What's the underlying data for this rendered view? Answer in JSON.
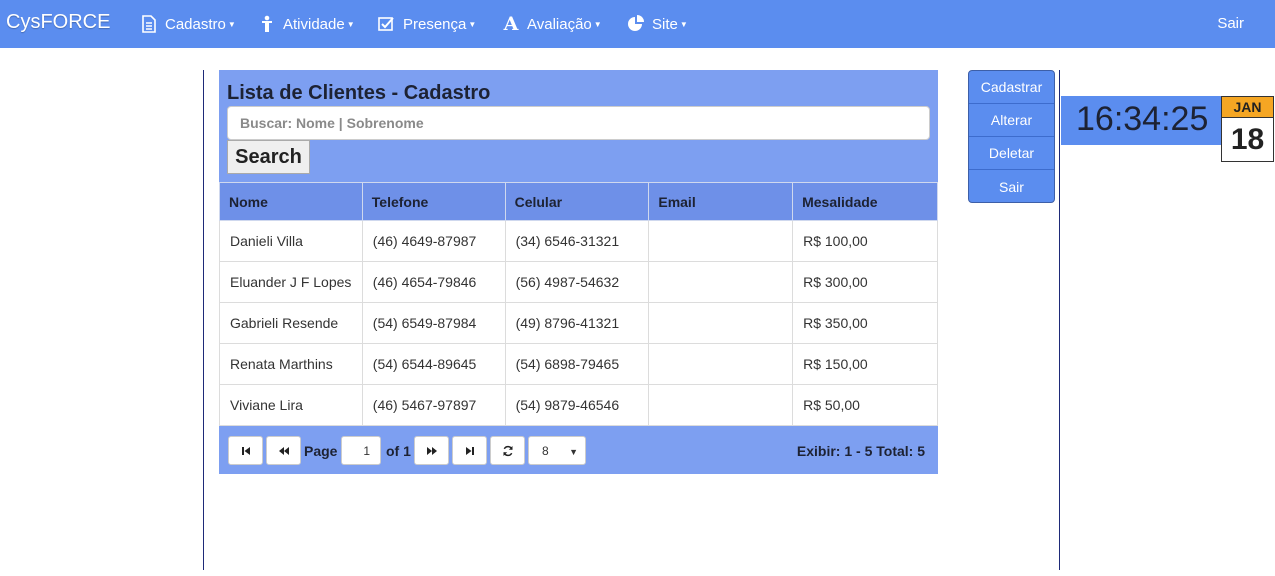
{
  "navbar": {
    "brand": "CysFORCE",
    "items": [
      {
        "label": "Cadastro",
        "icon": "document-icon"
      },
      {
        "label": "Atividade",
        "icon": "figure-icon"
      },
      {
        "label": "Presença",
        "icon": "checkbox-icon"
      },
      {
        "label": "Avaliação",
        "icon": "letter-a-icon"
      },
      {
        "label": "Site",
        "icon": "pie-chart-icon"
      }
    ],
    "logout_label": "Sair"
  },
  "panel": {
    "title": "Lista de Clientes - Cadastro",
    "search_placeholder": "Buscar: Nome | Sobrenome",
    "search_button": "Search"
  },
  "table": {
    "headers": [
      "Nome",
      "Telefone",
      "Celular",
      "Email",
      "Mesalidade"
    ],
    "rows": [
      [
        "Danieli Villa",
        "(46) 4649-87987",
        "(34) 6546-31321",
        "",
        "R$ 100,00"
      ],
      [
        "Eluander J F Lopes",
        "(46) 4654-79846",
        "(56) 4987-54632",
        "",
        "R$ 300,00"
      ],
      [
        "Gabrieli Resende",
        "(54) 6549-87984",
        "(49) 8796-41321",
        "",
        "R$ 350,00"
      ],
      [
        "Renata Marthins",
        "(54) 6544-89645",
        "(54) 6898-79465",
        "",
        "R$ 150,00"
      ],
      [
        "Viviane Lira",
        "(46) 5467-97897",
        "(54) 9879-46546",
        "",
        "R$ 50,00"
      ]
    ]
  },
  "pager": {
    "page_label": "Page",
    "page_value": "1",
    "of_label": "of 1",
    "page_size": "8",
    "info": "Exibir: 1 - 5 Total: 5"
  },
  "side_menu": {
    "items": [
      "Cadastrar",
      "Alterar",
      "Deletar",
      "Sair"
    ]
  },
  "clock": {
    "time": "16:34:25",
    "month": "JAN",
    "day": "18"
  },
  "colors": {
    "navbar": "#5b8def",
    "panel_header": "#7d9ff1",
    "table_header": "#6e90e8",
    "calendar_month": "#f5a623"
  }
}
